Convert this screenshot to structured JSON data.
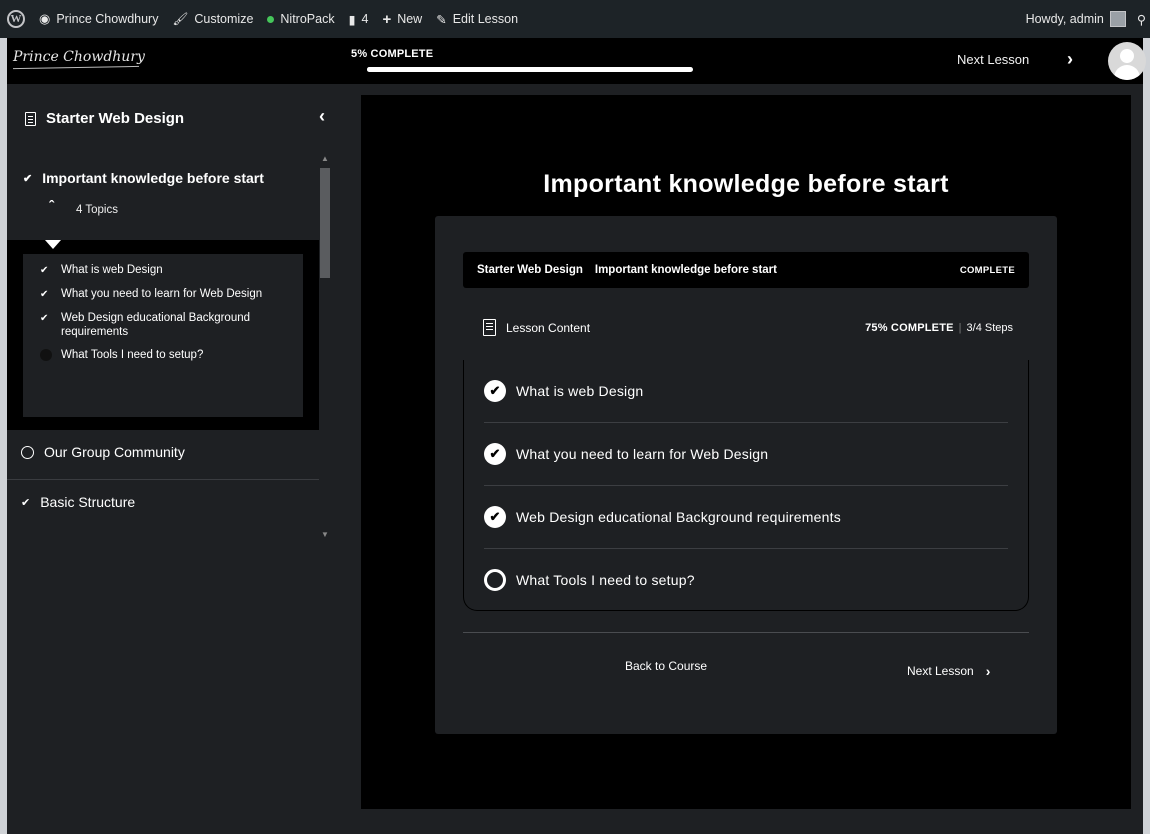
{
  "adminbar": {
    "site_name": "Prince Chowdhury",
    "customize": "Customize",
    "nitropack": "NitroPack",
    "comments_count": "4",
    "new": "New",
    "edit": "Edit Lesson",
    "howdy": "Howdy, admin"
  },
  "topbar": {
    "logo": "Prince Chowdhury",
    "progress_label": "5% COMPLETE",
    "progress_fraction": 0.05,
    "next_lesson": "Next Lesson"
  },
  "sidebar": {
    "course_title": "Starter Web Design",
    "active_lesson": {
      "title": "Important knowledge before start",
      "topics_count": "4 Topics",
      "topics": [
        {
          "label": "What is web Design",
          "done": true
        },
        {
          "label": "What you need to learn for Web Design",
          "done": true
        },
        {
          "label": "Web Design educational Background requirements",
          "done": true
        },
        {
          "label": "What Tools I need to setup?",
          "done": false
        }
      ]
    },
    "lessons": [
      {
        "label": "Our Group Community",
        "done": false
      },
      {
        "label": "Basic Structure",
        "done": true
      }
    ]
  },
  "main": {
    "heading": "Important knowledge before start",
    "breadcrumb": {
      "course": "Starter Web Design",
      "lesson": "Important knowledge before start",
      "status": "COMPLETE"
    },
    "lesson_content": {
      "label": "Lesson Content",
      "percent": "75% COMPLETE",
      "steps": "3/4 Steps"
    },
    "topics": [
      {
        "label": "What is web Design",
        "done": true
      },
      {
        "label": "What you need to learn for Web Design",
        "done": true
      },
      {
        "label": "Web Design educational Background requirements",
        "done": true
      },
      {
        "label": "What Tools I need to setup?",
        "done": false
      }
    ],
    "back_to_course": "Back to Course",
    "next_lesson": "Next Lesson"
  },
  "icons": {
    "wordpress": "wordpress-logo-icon",
    "dashboard": "dashboard-icon",
    "customize": "brush-icon",
    "comments": "comment-icon",
    "new": "plus-icon",
    "edit": "pencil-icon",
    "search": "search-icon",
    "check": "checkmark-icon",
    "lesson": "document-icon"
  },
  "colors": {
    "background": "#1e2023",
    "content_bg": "#000000",
    "adminbar": "#1d2327",
    "text": "#ffffff",
    "nitro_status": "#45c65a"
  }
}
